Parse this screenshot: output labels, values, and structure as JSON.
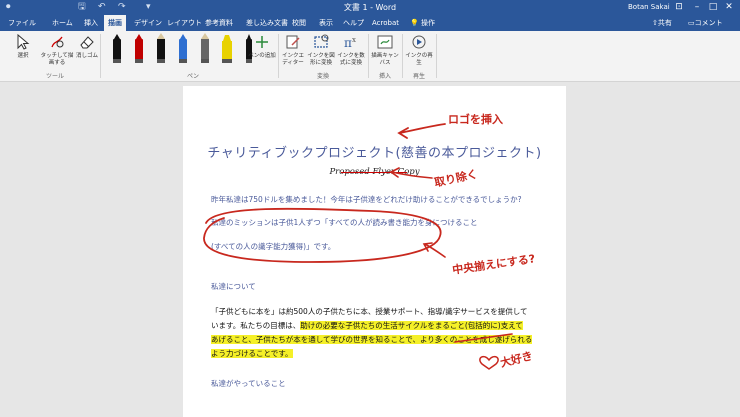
{
  "window": {
    "title": "文書 1 - Word",
    "user": "Botan Sakai"
  },
  "tabs": [
    "ファイル",
    "ホーム",
    "挿入",
    "描画",
    "デザイン",
    "レイアウト",
    "参考資料",
    "差し込み文書",
    "校閲",
    "表示",
    "ヘルプ",
    "Acrobat"
  ],
  "active_tab": "描画",
  "tell_me": "操作",
  "share_label": "共有",
  "comment_label": "コメント",
  "ribbon": {
    "tools": {
      "select": "選択",
      "touch_draw": "タッチして描画する",
      "eraser": "消しゴム",
      "group": "ツール"
    },
    "pens": {
      "add_pen": "ペンの追加",
      "group": "ペン",
      "colors": [
        "#111111",
        "#c00000",
        "#111111",
        "#2e6fd1",
        "#666666",
        "#e8d200",
        "#111111"
      ]
    },
    "convert": {
      "ink_editor": "インクエディター",
      "ink_to_shape": "インクを図形に変換",
      "ink_to_math": "インクを数式に変換",
      "group": "変換"
    },
    "insert": {
      "drawing_canvas": "描画キャンバス",
      "group": "挿入"
    },
    "replay": {
      "ink_replay": "インクの再生",
      "group": "再生"
    }
  },
  "document": {
    "heading": "チャリティブックプロジェクト(慈善の本プロジェクト)",
    "subtitle": "Proposed Flyer Copy",
    "para1": "昨年私達は750ドルを集めました！今年は子供達をどれだけ助けることができるでしょうか?",
    "para2_line1": "私達のミッションは子供1人ずつ「すべての人が読み書き能力を身につけること",
    "para2_line2": "(すべての人の識字能力獲得)」です。",
    "section1": "私達について",
    "body_line1": "「子供どもに本を」は約500人の子供たちに本、授業サポート、指導/識字サービスを提供して",
    "body_line2a": "います。私たちの目標は、",
    "body_line2b": "助けの必要な子供たちの生活サイクルをまるごと(包括的に)支えて",
    "body_line3": "あげること、子供たちが本を通して学びの世界を知ることで、より多くのことを成し遂げられる",
    "body_line4": "よう力づけることです。",
    "section2": "私達がやっていること"
  },
  "annotations": {
    "insert_logo": "ロゴを挿入",
    "remove": "取り除く",
    "center_align": "中央揃えにする?",
    "love_it": "大好き"
  },
  "colors": {
    "brand": "#2b579a",
    "ink_red": "#c8281e",
    "highlight": "#f5f028",
    "heading_blue": "#4a5a9a"
  }
}
